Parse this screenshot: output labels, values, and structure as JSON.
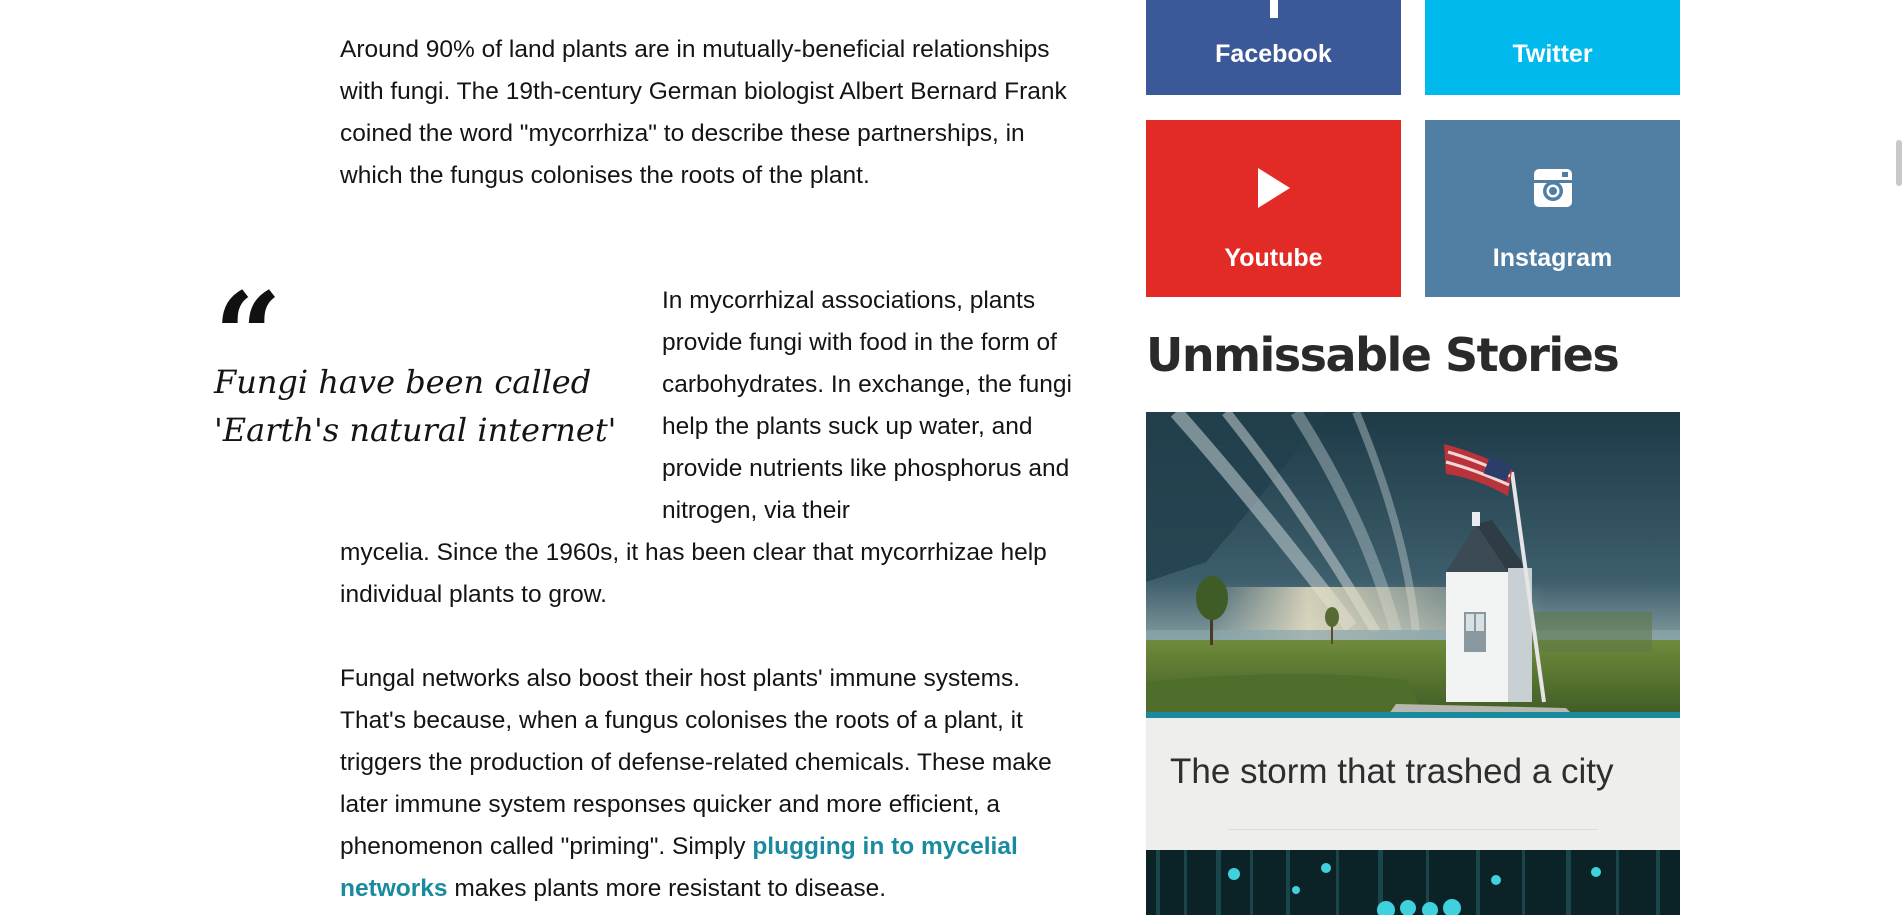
{
  "article": {
    "para1": "Around 90% of land plants are in mutually-beneficial relationships with fungi. The 19th-century German biologist Albert Bernard Frank coined the word \"mycorrhiza\" to describe these partnerships, in which the fungus colonises the roots of the plant.",
    "pullquote": {
      "mark": "“",
      "text": "Fungi have been called 'Earth's natural internet'"
    },
    "para2_wrapped": "In mycorrhizal associations, plants provide fungi with food in the form of carbohydrates. In exchange, the fungi help the plants suck up water, and provide nutrients like phosphorus and nitrogen, via their",
    "para2_cont": "mycelia. Since the 1960s, it has been clear that mycorrhizae help individual plants to grow.",
    "para3": {
      "before_link": "Fungal networks also boost their host plants' immune systems. That's because, when a fungus colonises the roots of a plant, it triggers the production of defense-related chemicals. These make later immune system responses quicker and more efficient, a phenomenon called \"priming\". Simply ",
      "link": "plugging in to mycelial networks",
      "after_link": " makes plants more resistant to disease."
    }
  },
  "sidebar": {
    "social": [
      {
        "name": "Facebook",
        "icon": "facebook-icon",
        "color": "#3b5998"
      },
      {
        "name": "Twitter",
        "icon": "twitter-icon",
        "color": "#00b9ed"
      },
      {
        "name": "Youtube",
        "icon": "youtube-icon",
        "color": "#e22b27"
      },
      {
        "name": "Instagram",
        "icon": "instagram-icon",
        "color": "#517fa4"
      }
    ],
    "section_title": "Unmissable Stories",
    "stories": [
      {
        "title": "The storm that trashed a city",
        "accent": "#1a8b9f"
      }
    ]
  },
  "colors": {
    "link": "#1a8b9f",
    "text": "#141414",
    "caption_bg": "#eeeeec"
  }
}
